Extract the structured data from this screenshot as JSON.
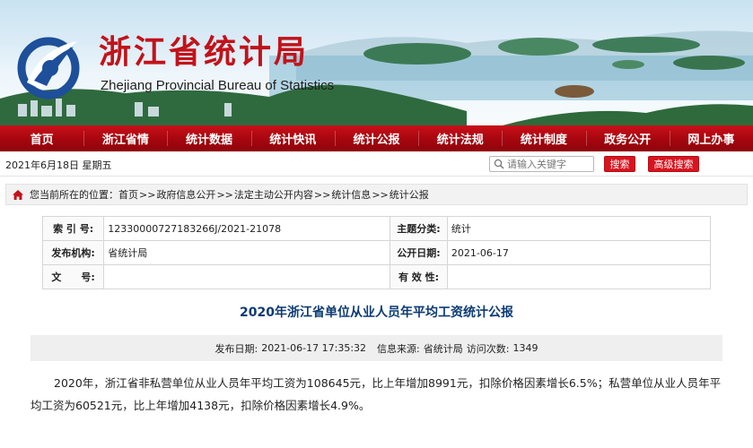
{
  "header": {
    "title": "浙江省统计局",
    "subtitle": "Zhejiang Provincial Bureau of Statistics",
    "logo_icon": "zhejiang-statistics-logo",
    "colors": {
      "brand_red": "#c2121a",
      "nav_red": "#a5060e",
      "title_blue": "#0d3b73"
    }
  },
  "nav": {
    "items": [
      {
        "label": "首页"
      },
      {
        "label": "浙江省情"
      },
      {
        "label": "统计数据"
      },
      {
        "label": "统计快讯"
      },
      {
        "label": "统计公报"
      },
      {
        "label": "统计法规"
      },
      {
        "label": "统计制度"
      },
      {
        "label": "政务公开"
      },
      {
        "label": "网上办事"
      }
    ]
  },
  "infobar": {
    "date": "2021年6月18日 星期五",
    "search": {
      "placeholder": "请输入关键字",
      "icon": "search-icon"
    },
    "search_button": "搜索",
    "advanced_button": "高级搜索"
  },
  "breadcrumb": {
    "icon": "home-icon",
    "prefix": "您当前所在的位置：",
    "items": [
      {
        "label": "首页"
      },
      {
        "label": "政府信息公开"
      },
      {
        "label": "法定主动公开内容"
      },
      {
        "label": "统计信息"
      },
      {
        "label": "统计公报"
      }
    ],
    "separator": ">>"
  },
  "meta": {
    "rows": [
      {
        "k1": "索 引 号:",
        "v1": "12330000727183266J/2021-21078",
        "k2": "主题分类:",
        "v2": "统计"
      },
      {
        "k1": "发布机构:",
        "v1": "省统计局",
        "k2": "公开日期:",
        "v2": "2021-06-17"
      },
      {
        "k1": "文　　号:",
        "v1": "",
        "k2": "有 效 性:",
        "v2": ""
      }
    ]
  },
  "article": {
    "title": "2020年浙江省单位从业人员年平均工资统计公报",
    "publish_label": "发布日期:",
    "publish_date": "2021-06-17 17:35:32",
    "source_label": "信息来源:",
    "source": "省统计局",
    "visits_label": "访问次数:",
    "visits": "1349",
    "paragraph": "2020年，浙江省非私营单位从业人员年平均工资为108645元，比上年增加8991元，扣除价格因素增长6.5%；私营单位从业人员年平均工资为60521元，比上年增加4138元，扣除价格因素增长4.9%。"
  }
}
